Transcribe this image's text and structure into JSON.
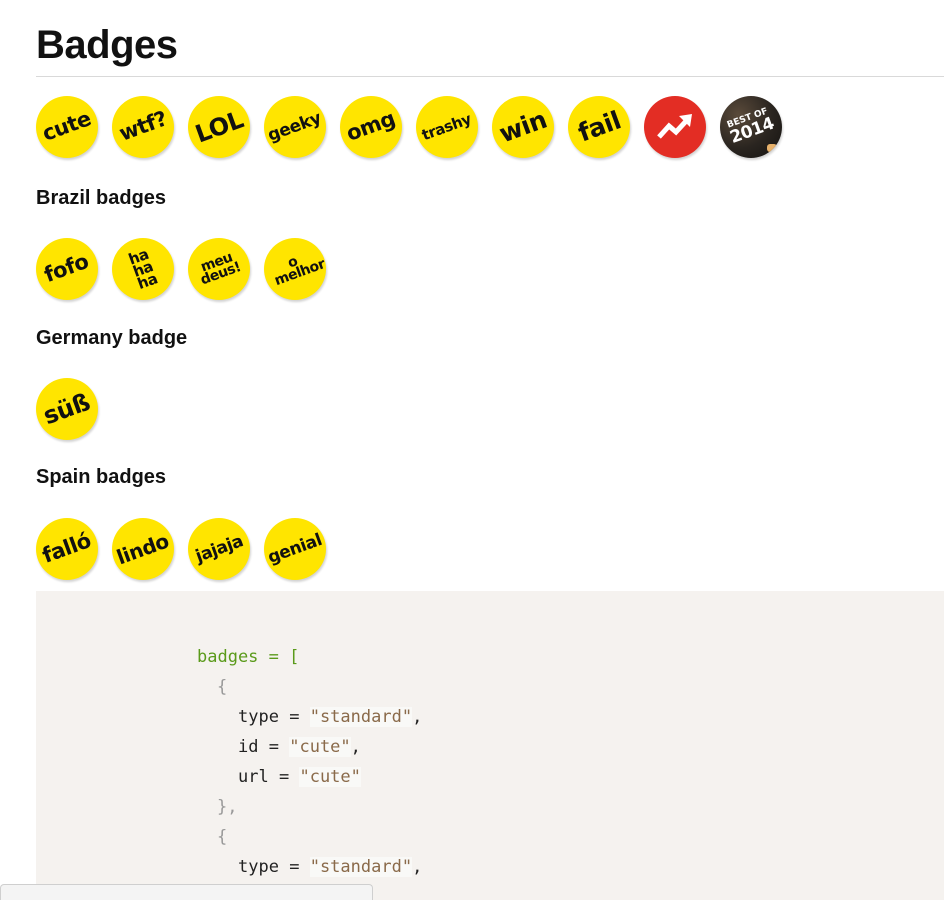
{
  "title": "Badges",
  "badges": [
    {
      "label": "cute",
      "icon": "badge-cute-icon"
    },
    {
      "label": "wtf?",
      "icon": "badge-wtf-icon"
    },
    {
      "label": "LOL",
      "icon": "badge-lol-icon"
    },
    {
      "label": "geeky",
      "icon": "badge-geeky-icon"
    },
    {
      "label": "omg",
      "icon": "badge-omg-icon"
    },
    {
      "label": "trashy",
      "icon": "badge-trashy-icon"
    },
    {
      "label": "win",
      "icon": "badge-win-icon"
    },
    {
      "label": "fail",
      "icon": "badge-fail-icon"
    },
    {
      "label": "",
      "icon": "trending-arrow-icon"
    },
    {
      "label": "BEST OF 2014",
      "icon": "best-of-2014-icon",
      "line1": "BEST OF",
      "line2": "2014"
    }
  ],
  "sections": [
    {
      "heading": "Brazil badges",
      "badges": [
        "fofo",
        "ha ha ha",
        "meu deus!",
        "o melhor"
      ]
    },
    {
      "heading": "Germany badge",
      "badges": [
        "süß"
      ]
    },
    {
      "heading": "Spain badges",
      "badges": [
        "falló",
        "lindo",
        "jajaja",
        "genial"
      ]
    }
  ],
  "code": {
    "var": "badges",
    "op": "=",
    "bracket": "[",
    "brace_open": "{",
    "brace_close": "},",
    "comma": ",",
    "items": [
      {
        "type": "\"standard\"",
        "id": "\"cute\"",
        "url": "\"cute\""
      },
      {
        "type": "\"standard\""
      }
    ],
    "keys": {
      "type": "type",
      "id": "id",
      "url": "url"
    }
  },
  "colors": {
    "badge_yellow": "#ffe500",
    "trending_red": "#e32d24",
    "code_bg": "#f5f2ef",
    "code_green": "#5a9a1a",
    "code_string": "#8a6a4a"
  }
}
